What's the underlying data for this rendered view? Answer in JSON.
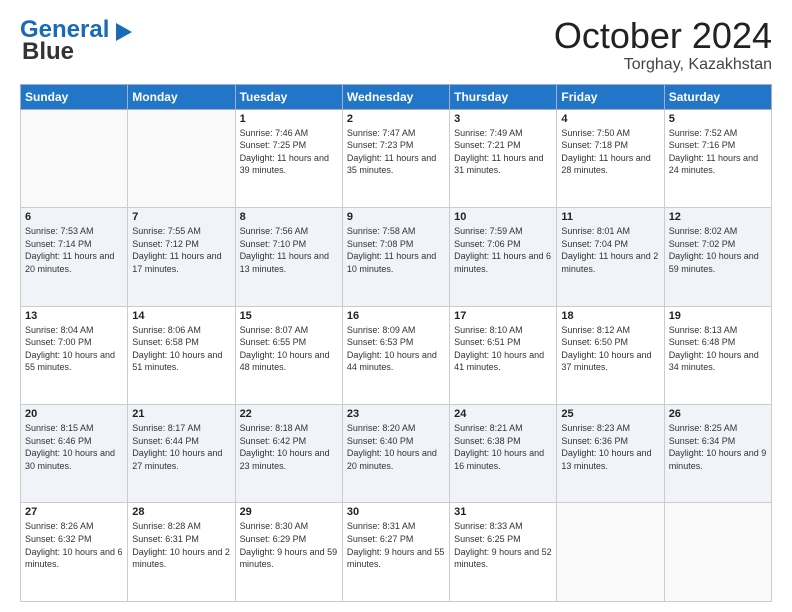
{
  "header": {
    "logo_line1": "General",
    "logo_line2": "Blue",
    "month": "October 2024",
    "location": "Torghay, Kazakhstan"
  },
  "weekdays": [
    "Sunday",
    "Monday",
    "Tuesday",
    "Wednesday",
    "Thursday",
    "Friday",
    "Saturday"
  ],
  "weeks": [
    [
      {
        "day": "",
        "info": ""
      },
      {
        "day": "",
        "info": ""
      },
      {
        "day": "1",
        "info": "Sunrise: 7:46 AM\nSunset: 7:25 PM\nDaylight: 11 hours and 39 minutes."
      },
      {
        "day": "2",
        "info": "Sunrise: 7:47 AM\nSunset: 7:23 PM\nDaylight: 11 hours and 35 minutes."
      },
      {
        "day": "3",
        "info": "Sunrise: 7:49 AM\nSunset: 7:21 PM\nDaylight: 11 hours and 31 minutes."
      },
      {
        "day": "4",
        "info": "Sunrise: 7:50 AM\nSunset: 7:18 PM\nDaylight: 11 hours and 28 minutes."
      },
      {
        "day": "5",
        "info": "Sunrise: 7:52 AM\nSunset: 7:16 PM\nDaylight: 11 hours and 24 minutes."
      }
    ],
    [
      {
        "day": "6",
        "info": "Sunrise: 7:53 AM\nSunset: 7:14 PM\nDaylight: 11 hours and 20 minutes."
      },
      {
        "day": "7",
        "info": "Sunrise: 7:55 AM\nSunset: 7:12 PM\nDaylight: 11 hours and 17 minutes."
      },
      {
        "day": "8",
        "info": "Sunrise: 7:56 AM\nSunset: 7:10 PM\nDaylight: 11 hours and 13 minutes."
      },
      {
        "day": "9",
        "info": "Sunrise: 7:58 AM\nSunset: 7:08 PM\nDaylight: 11 hours and 10 minutes."
      },
      {
        "day": "10",
        "info": "Sunrise: 7:59 AM\nSunset: 7:06 PM\nDaylight: 11 hours and 6 minutes."
      },
      {
        "day": "11",
        "info": "Sunrise: 8:01 AM\nSunset: 7:04 PM\nDaylight: 11 hours and 2 minutes."
      },
      {
        "day": "12",
        "info": "Sunrise: 8:02 AM\nSunset: 7:02 PM\nDaylight: 10 hours and 59 minutes."
      }
    ],
    [
      {
        "day": "13",
        "info": "Sunrise: 8:04 AM\nSunset: 7:00 PM\nDaylight: 10 hours and 55 minutes."
      },
      {
        "day": "14",
        "info": "Sunrise: 8:06 AM\nSunset: 6:58 PM\nDaylight: 10 hours and 51 minutes."
      },
      {
        "day": "15",
        "info": "Sunrise: 8:07 AM\nSunset: 6:55 PM\nDaylight: 10 hours and 48 minutes."
      },
      {
        "day": "16",
        "info": "Sunrise: 8:09 AM\nSunset: 6:53 PM\nDaylight: 10 hours and 44 minutes."
      },
      {
        "day": "17",
        "info": "Sunrise: 8:10 AM\nSunset: 6:51 PM\nDaylight: 10 hours and 41 minutes."
      },
      {
        "day": "18",
        "info": "Sunrise: 8:12 AM\nSunset: 6:50 PM\nDaylight: 10 hours and 37 minutes."
      },
      {
        "day": "19",
        "info": "Sunrise: 8:13 AM\nSunset: 6:48 PM\nDaylight: 10 hours and 34 minutes."
      }
    ],
    [
      {
        "day": "20",
        "info": "Sunrise: 8:15 AM\nSunset: 6:46 PM\nDaylight: 10 hours and 30 minutes."
      },
      {
        "day": "21",
        "info": "Sunrise: 8:17 AM\nSunset: 6:44 PM\nDaylight: 10 hours and 27 minutes."
      },
      {
        "day": "22",
        "info": "Sunrise: 8:18 AM\nSunset: 6:42 PM\nDaylight: 10 hours and 23 minutes."
      },
      {
        "day": "23",
        "info": "Sunrise: 8:20 AM\nSunset: 6:40 PM\nDaylight: 10 hours and 20 minutes."
      },
      {
        "day": "24",
        "info": "Sunrise: 8:21 AM\nSunset: 6:38 PM\nDaylight: 10 hours and 16 minutes."
      },
      {
        "day": "25",
        "info": "Sunrise: 8:23 AM\nSunset: 6:36 PM\nDaylight: 10 hours and 13 minutes."
      },
      {
        "day": "26",
        "info": "Sunrise: 8:25 AM\nSunset: 6:34 PM\nDaylight: 10 hours and 9 minutes."
      }
    ],
    [
      {
        "day": "27",
        "info": "Sunrise: 8:26 AM\nSunset: 6:32 PM\nDaylight: 10 hours and 6 minutes."
      },
      {
        "day": "28",
        "info": "Sunrise: 8:28 AM\nSunset: 6:31 PM\nDaylight: 10 hours and 2 minutes."
      },
      {
        "day": "29",
        "info": "Sunrise: 8:30 AM\nSunset: 6:29 PM\nDaylight: 9 hours and 59 minutes."
      },
      {
        "day": "30",
        "info": "Sunrise: 8:31 AM\nSunset: 6:27 PM\nDaylight: 9 hours and 55 minutes."
      },
      {
        "day": "31",
        "info": "Sunrise: 8:33 AM\nSunset: 6:25 PM\nDaylight: 9 hours and 52 minutes."
      },
      {
        "day": "",
        "info": ""
      },
      {
        "day": "",
        "info": ""
      }
    ]
  ]
}
